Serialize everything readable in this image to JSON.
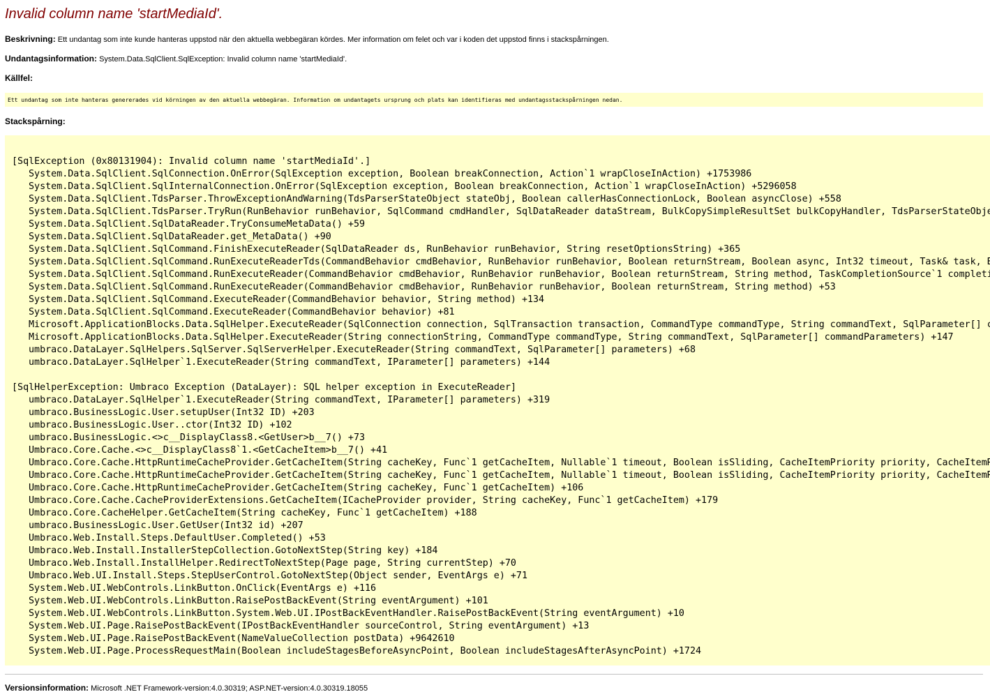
{
  "title": "Invalid column name 'startMediaId'.",
  "description": {
    "label": "Beskrivning:",
    "text": "Ett undantag som inte kunde hanteras uppstod när den aktuella webbegäran kördes. Mer information om felet och var i koden det uppstod finns i stackspårningen."
  },
  "exception_info": {
    "label": "Undantagsinformation:",
    "text": "System.Data.SqlClient.SqlException: Invalid column name 'startMediaId'."
  },
  "source_error": {
    "label": "Källfel:",
    "text": "Ett undantag som inte hanteras genererades vid körningen av den aktuella webbegäran. Information om undantagets ursprung och plats kan identifieras med undantagsstackspårningen nedan."
  },
  "stack_trace": {
    "label": "Stackspårning:",
    "lines": [
      {
        "kind": "header",
        "text": "[SqlException (0x80131904): Invalid column name 'startMediaId'.]"
      },
      {
        "kind": "frame",
        "text": "System.Data.SqlClient.SqlConnection.OnError(SqlException exception, Boolean breakConnection, Action`1 wrapCloseInAction) +1753986"
      },
      {
        "kind": "frame",
        "text": "System.Data.SqlClient.SqlInternalConnection.OnError(SqlException exception, Boolean breakConnection, Action`1 wrapCloseInAction) +5296058"
      },
      {
        "kind": "frame",
        "text": "System.Data.SqlClient.TdsParser.ThrowExceptionAndWarning(TdsParserStateObject stateObj, Boolean callerHasConnectionLock, Boolean asyncClose) +558"
      },
      {
        "kind": "frame",
        "text": "System.Data.SqlClient.TdsParser.TryRun(RunBehavior runBehavior, SqlCommand cmdHandler, SqlDataReader dataStream, BulkCopySimpleResultSet bulkCopyHandler, TdsParserStateObje"
      },
      {
        "kind": "frame",
        "text": "System.Data.SqlClient.SqlDataReader.TryConsumeMetaData() +59"
      },
      {
        "kind": "frame",
        "text": "System.Data.SqlClient.SqlDataReader.get_MetaData() +90"
      },
      {
        "kind": "frame",
        "text": "System.Data.SqlClient.SqlCommand.FinishExecuteReader(SqlDataReader ds, RunBehavior runBehavior, String resetOptionsString) +365"
      },
      {
        "kind": "frame",
        "text": "System.Data.SqlClient.SqlCommand.RunExecuteReaderTds(CommandBehavior cmdBehavior, RunBehavior runBehavior, Boolean returnStream, Boolean async, Int32 timeout, Task& task, B"
      },
      {
        "kind": "frame",
        "text": "System.Data.SqlClient.SqlCommand.RunExecuteReader(CommandBehavior cmdBehavior, RunBehavior runBehavior, Boolean returnStream, String method, TaskCompletionSource`1 completi"
      },
      {
        "kind": "frame",
        "text": "System.Data.SqlClient.SqlCommand.RunExecuteReader(CommandBehavior cmdBehavior, RunBehavior runBehavior, Boolean returnStream, String method) +53"
      },
      {
        "kind": "frame",
        "text": "System.Data.SqlClient.SqlCommand.ExecuteReader(CommandBehavior behavior, String method) +134"
      },
      {
        "kind": "frame",
        "text": "System.Data.SqlClient.SqlCommand.ExecuteReader(CommandBehavior behavior) +81"
      },
      {
        "kind": "frame",
        "text": "Microsoft.ApplicationBlocks.Data.SqlHelper.ExecuteReader(SqlConnection connection, SqlTransaction transaction, CommandType commandType, String commandText, SqlParameter[] c"
      },
      {
        "kind": "frame",
        "text": "Microsoft.ApplicationBlocks.Data.SqlHelper.ExecuteReader(String connectionString, CommandType commandType, String commandText, SqlParameter[] commandParameters) +147"
      },
      {
        "kind": "frame",
        "text": "umbraco.DataLayer.SqlHelpers.SqlServer.SqlServerHelper.ExecuteReader(String commandText, SqlParameter[] parameters) +68"
      },
      {
        "kind": "frame",
        "text": "umbraco.DataLayer.SqlHelper`1.ExecuteReader(String commandText, IParameter[] parameters) +144"
      },
      {
        "kind": "blank",
        "text": ""
      },
      {
        "kind": "header",
        "text": "[SqlHelperException: Umbraco Exception (DataLayer): SQL helper exception in ExecuteReader]"
      },
      {
        "kind": "frame",
        "text": "umbraco.DataLayer.SqlHelper`1.ExecuteReader(String commandText, IParameter[] parameters) +319"
      },
      {
        "kind": "frame",
        "text": "umbraco.BusinessLogic.User.setupUser(Int32 ID) +203"
      },
      {
        "kind": "frame",
        "text": "umbraco.BusinessLogic.User..ctor(Int32 ID) +102"
      },
      {
        "kind": "frame",
        "text": "umbraco.BusinessLogic.<>c__DisplayClass8.<GetUser>b__7() +73"
      },
      {
        "kind": "frame",
        "text": "Umbraco.Core.Cache.<>c__DisplayClass8`1.<GetCacheItem>b__7() +41"
      },
      {
        "kind": "frame",
        "text": "Umbraco.Core.Cache.HttpRuntimeCacheProvider.GetCacheItem(String cacheKey, Func`1 getCacheItem, Nullable`1 timeout, Boolean isSliding, CacheItemPriority priority, CacheItemR"
      },
      {
        "kind": "frame",
        "text": "Umbraco.Core.Cache.HttpRuntimeCacheProvider.GetCacheItem(String cacheKey, Func`1 getCacheItem, Nullable`1 timeout, Boolean isSliding, CacheItemPriority priority, CacheItemR"
      },
      {
        "kind": "frame",
        "text": "Umbraco.Core.Cache.HttpRuntimeCacheProvider.GetCacheItem(String cacheKey, Func`1 getCacheItem) +106"
      },
      {
        "kind": "frame",
        "text": "Umbraco.Core.Cache.CacheProviderExtensions.GetCacheItem(ICacheProvider provider, String cacheKey, Func`1 getCacheItem) +179"
      },
      {
        "kind": "frame",
        "text": "Umbraco.Core.CacheHelper.GetCacheItem(String cacheKey, Func`1 getCacheItem) +188"
      },
      {
        "kind": "frame",
        "text": "umbraco.BusinessLogic.User.GetUser(Int32 id) +207"
      },
      {
        "kind": "frame",
        "text": "Umbraco.Web.Install.Steps.DefaultUser.Completed() +53"
      },
      {
        "kind": "frame",
        "text": "Umbraco.Web.Install.InstallerStepCollection.GotoNextStep(String key) +184"
      },
      {
        "kind": "frame",
        "text": "Umbraco.Web.Install.InstallHelper.RedirectToNextStep(Page page, String currentStep) +70"
      },
      {
        "kind": "frame",
        "text": "Umbraco.Web.UI.Install.Steps.StepUserControl.GotoNextStep(Object sender, EventArgs e) +71"
      },
      {
        "kind": "frame",
        "text": "System.Web.UI.WebControls.LinkButton.OnClick(EventArgs e) +116"
      },
      {
        "kind": "frame",
        "text": "System.Web.UI.WebControls.LinkButton.RaisePostBackEvent(String eventArgument) +101"
      },
      {
        "kind": "frame",
        "text": "System.Web.UI.WebControls.LinkButton.System.Web.UI.IPostBackEventHandler.RaisePostBackEvent(String eventArgument) +10"
      },
      {
        "kind": "frame",
        "text": "System.Web.UI.Page.RaisePostBackEvent(IPostBackEventHandler sourceControl, String eventArgument) +13"
      },
      {
        "kind": "frame",
        "text": "System.Web.UI.Page.RaisePostBackEvent(NameValueCollection postData) +9642610"
      },
      {
        "kind": "frame",
        "text": "System.Web.UI.Page.ProcessRequestMain(Boolean includeStagesBeforeAsyncPoint, Boolean includeStagesAfterAsyncPoint) +1724"
      }
    ]
  },
  "version_info": {
    "label": "Versionsinformation:",
    "text": "Microsoft .NET Framework-version:4.0.30319; ASP.NET-version:4.0.30319.18055"
  },
  "colors": {
    "title": "#800000",
    "code_background": "#ffffcc",
    "divider": "#c0c0c0"
  }
}
